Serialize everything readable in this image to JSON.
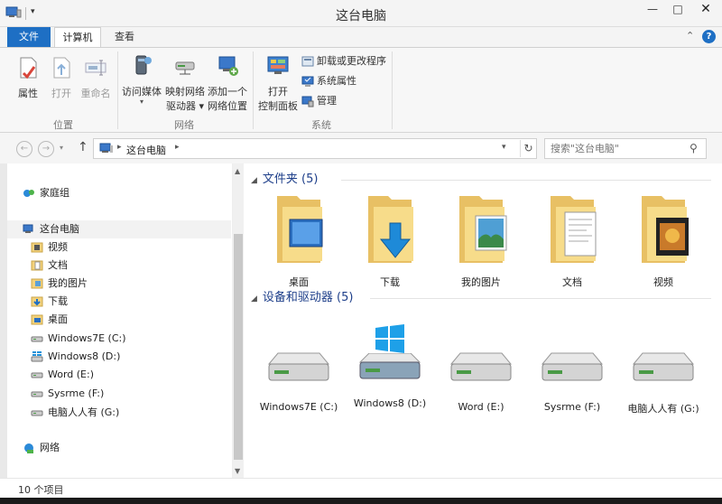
{
  "window": {
    "title": "这台电脑",
    "min": "—",
    "max": "□",
    "close": "✕",
    "qa_arrow": "▾"
  },
  "tabs": {
    "file": "文件",
    "computer": "计算机",
    "view": "查看",
    "collapse": "⌃",
    "help": "?"
  },
  "ribbon": {
    "location": {
      "label": "位置",
      "properties": "属性",
      "open": "打开",
      "rename": "重命名"
    },
    "network": {
      "label": "网络",
      "access_media": "访问媒体",
      "map_drive_1": "映射网络",
      "map_drive_2": "驱动器 ▾",
      "add_location_1": "添加一个",
      "add_location_2": "网络位置"
    },
    "system": {
      "label": "系统",
      "open_cp_1": "打开",
      "open_cp_2": "控制面板",
      "uninstall": "卸载或更改程序",
      "sys_props": "系统属性",
      "manage": "管理"
    }
  },
  "address": {
    "crumb": "这台电脑",
    "crumb_sep": "▸",
    "dropdown": "▾",
    "refresh": "↻",
    "up": "↑",
    "back": "←",
    "forward": "→",
    "recent": "▾"
  },
  "search": {
    "placeholder": "搜索\"这台电脑\"",
    "icon": "⚲"
  },
  "nav": {
    "homegroup": "家庭组",
    "this_pc": "这台电脑",
    "items": [
      "视频",
      "文档",
      "我的图片",
      "下载",
      "桌面",
      "Windows7E (C:)",
      "Windows8 (D:)",
      "Word (E:)",
      "Sysrme (F:)",
      "电脑人人有 (G:)"
    ],
    "network": "网络"
  },
  "content": {
    "folders_header": "文件夹 (5)",
    "folders": [
      "桌面",
      "下载",
      "我的图片",
      "文档",
      "视频"
    ],
    "drives_header": "设备和驱动器 (5)",
    "drives": [
      "Windows7E (C:)",
      "Windows8 (D:)",
      "Word (E:)",
      "Sysrme (F:)",
      "电脑人人有 (G:)"
    ]
  },
  "status": {
    "count": "10 个项目"
  },
  "colors": {
    "accent": "#1e6fc4",
    "folder": "#f3d27c",
    "header_blue": "#1e3f8a"
  }
}
